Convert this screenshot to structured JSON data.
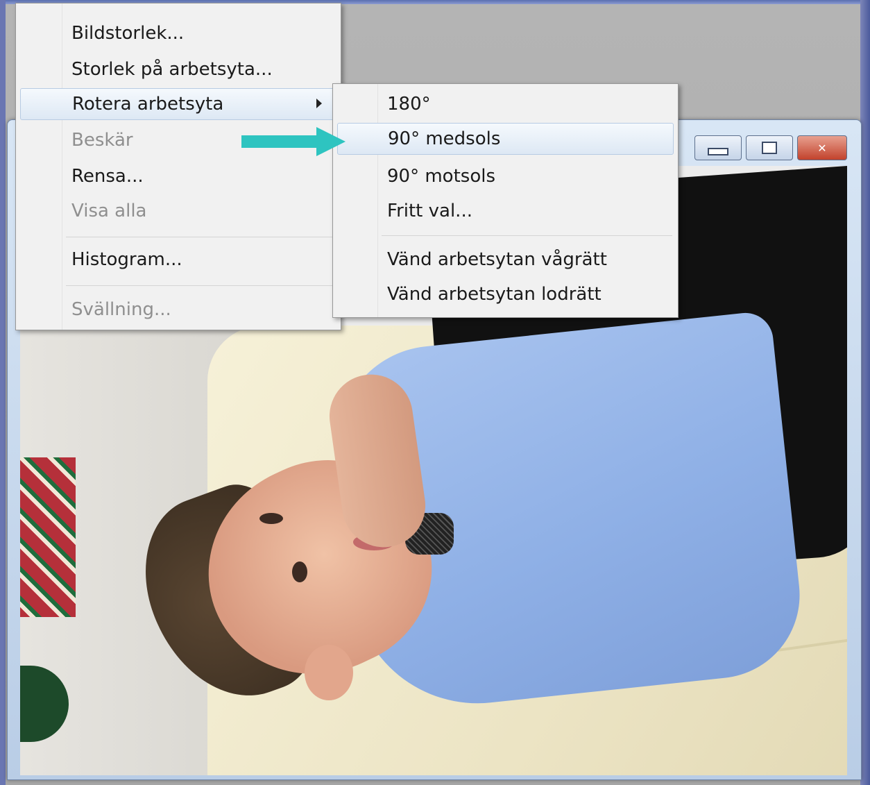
{
  "menu": {
    "items": [
      {
        "label": "Bildstorlek...",
        "enabled": true
      },
      {
        "label": "Storlek på arbetsyta...",
        "enabled": true
      },
      {
        "label": "Rotera arbetsyta",
        "enabled": true,
        "has_submenu": true,
        "highlighted": true
      },
      {
        "label": "Beskär",
        "enabled": false
      },
      {
        "label": "Rensa...",
        "enabled": true
      },
      {
        "label": "Visa alla",
        "enabled": false
      },
      {
        "label": "Histogram...",
        "enabled": true
      },
      {
        "label": "Svällning...",
        "enabled": false
      }
    ]
  },
  "submenu": {
    "items": [
      {
        "label": "180°"
      },
      {
        "label": "90° medsols",
        "highlighted": true
      },
      {
        "label": "90° motsols"
      },
      {
        "label": "Fritt val..."
      },
      {
        "label": "Vänd arbetsytan vågrätt"
      },
      {
        "label": "Vänd arbetsytan lodrätt"
      }
    ]
  },
  "window": {
    "controls": [
      "minimize",
      "maximize",
      "close"
    ]
  },
  "annotation": {
    "arrow_color": "#2ec4c0",
    "points_to": "90° medsols"
  },
  "colors": {
    "menu_bg": "#f1f1f1",
    "highlight": "#dde8f4",
    "disabled_text": "#8f8f8f",
    "close_button": "#c2422c"
  }
}
